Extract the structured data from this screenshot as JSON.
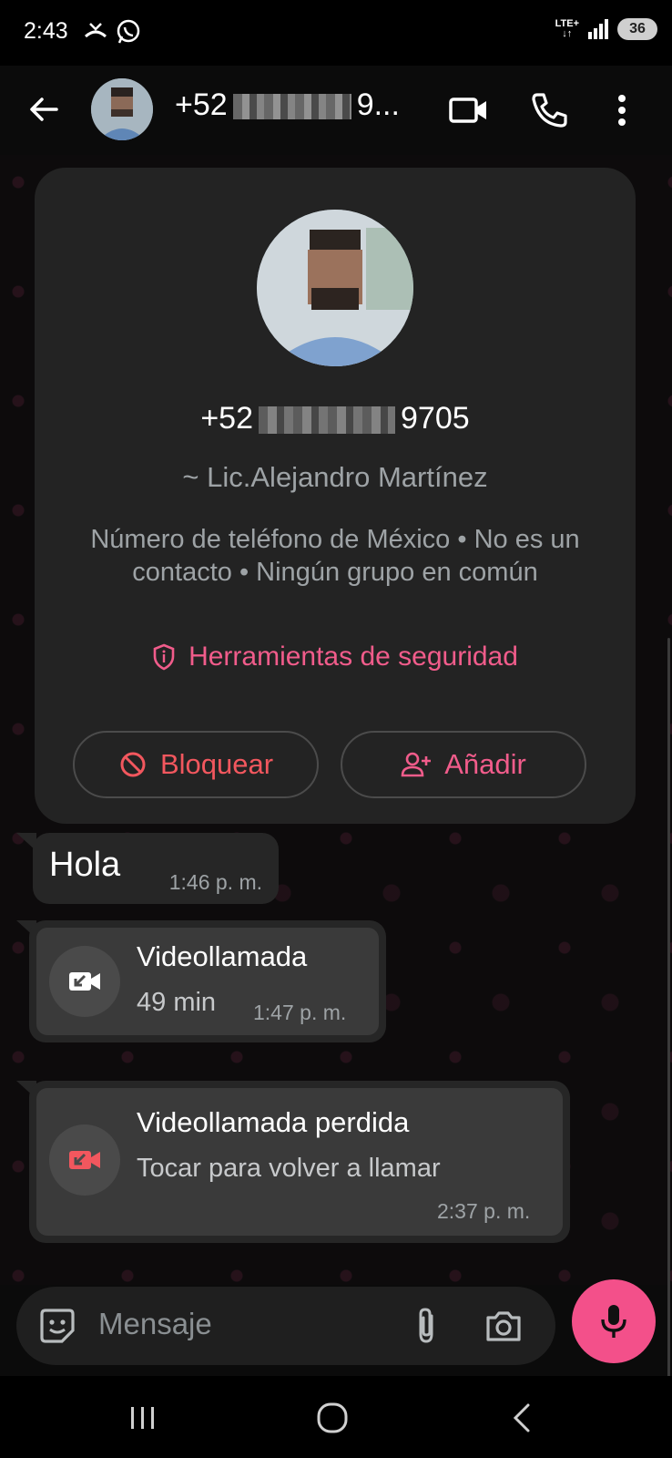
{
  "status_bar": {
    "time": "2:43",
    "network": "LTE+",
    "battery": "36"
  },
  "header": {
    "title_prefix": "+52",
    "title_suffix": "9..."
  },
  "contact_card": {
    "phone_prefix": "+52",
    "phone_suffix": "9705",
    "name": "~ Lic.Alejandro Martínez",
    "description": "Número de teléfono de México • No es un contacto • Ningún grupo en común",
    "security_link": "Herramientas de seguridad",
    "block_button": "Bloquear",
    "add_button": "Añadir"
  },
  "messages": [
    {
      "text": "Hola",
      "time": "1:46 p. m."
    },
    {
      "title": "Videollamada",
      "subtitle": "49 min",
      "time": "1:47 p. m."
    },
    {
      "title": "Videollamada perdida",
      "subtitle": "Tocar para volver a llamar",
      "time": "2:37 p. m."
    }
  ],
  "input": {
    "placeholder": "Mensaje"
  },
  "colors": {
    "accent": "#f15c8b",
    "danger": "#f2575e",
    "mic_button": "#f3508a"
  }
}
